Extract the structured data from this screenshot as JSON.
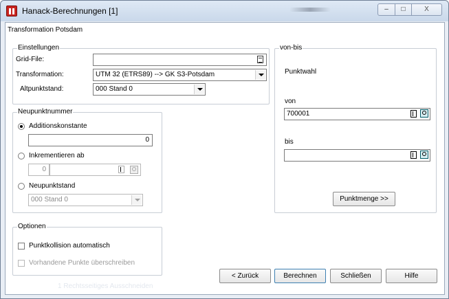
{
  "window": {
    "title": "Hanack-Berechnungen [1]",
    "controls": {
      "minimize": "–",
      "maximize": "□",
      "close": "X"
    }
  },
  "dialog": {
    "subtitle": "Transformation Potsdam",
    "einstellungen": {
      "legend": "Einstellungen",
      "grid_file_label": "Grid-File:",
      "grid_file_value": "",
      "transformation_label": "Transformation:",
      "transformation_value": "UTM 32 (ETRS89) --> GK S3-Potsdam",
      "altpunktstand_label": "Altpunktstand:",
      "altpunktstand_value": "000   Stand 0"
    },
    "neupunktnummer": {
      "legend": "Neupunktnummer",
      "additionskonstante_label": "Additionskonstante",
      "additionskonstante_value": "0",
      "additionskonstante_selected": true,
      "inkrementieren_label": "Inkrementieren ab",
      "inkrementieren_value": "0",
      "neupunktstand_label": "Neupunktstand",
      "neupunktstand_value": "000   Stand 0"
    },
    "von_bis": {
      "legend": "von-bis",
      "punktwahl_label": "Punktwahl",
      "von_label": "von",
      "von_value": "700001",
      "bis_label": "bis",
      "bis_value": "",
      "punktmenge_button": "Punktmenge >>"
    },
    "optionen": {
      "legend": "Optionen",
      "punktkollision_label": "Punktkollision automatisch",
      "punktkollision_checked": false,
      "vorhandene_label": "Vorhandene Punkte überschreiben",
      "vorhandene_checked": false
    },
    "buttons": {
      "back": "< Zurück",
      "compute": "Berechnen",
      "close": "Schließen",
      "help": "Hilfe"
    },
    "ghost_status": "1   Rechtsseitiges Ausschneiden"
  },
  "colors": {
    "title_bar": "#c9d8ea",
    "client_bg": "#ffffff",
    "group_border": "#c7cdd5",
    "default_button_border": "#3c7fb1"
  }
}
